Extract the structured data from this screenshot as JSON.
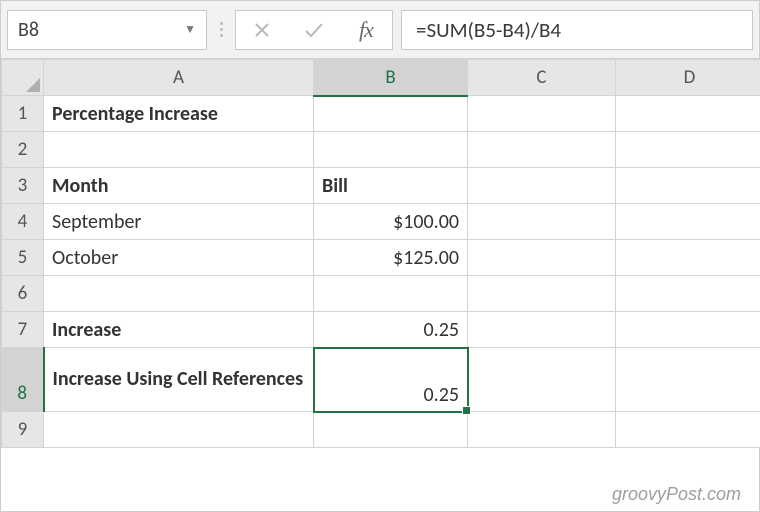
{
  "formula_bar": {
    "name_box": "B8",
    "formula": "=SUM(B5-B4)/B4",
    "fx_label": "fx"
  },
  "columns": [
    "A",
    "B",
    "C",
    "D"
  ],
  "rows": [
    "1",
    "2",
    "3",
    "4",
    "5",
    "6",
    "7",
    "8",
    "9"
  ],
  "active_row": "8",
  "active_col": "B",
  "cells": {
    "A1": "Percentage Increase",
    "A3": "Month",
    "B3": "Bill",
    "A4": "September",
    "B4": "$100.00",
    "A5": "October",
    "B5": "$125.00",
    "A7": "Increase",
    "B7": "0.25",
    "A8": "Increase Using Cell References",
    "B8": "0.25"
  },
  "watermark": "groovyPost.com",
  "chart_data": {
    "type": "table",
    "title": "Percentage Increase",
    "columns": [
      "Month",
      "Bill"
    ],
    "rows": [
      {
        "Month": "September",
        "Bill": 100.0
      },
      {
        "Month": "October",
        "Bill": 125.0
      }
    ],
    "derived": {
      "Increase": 0.25,
      "Increase Using Cell References": 0.25,
      "formula": "=SUM(B5-B4)/B4"
    }
  }
}
